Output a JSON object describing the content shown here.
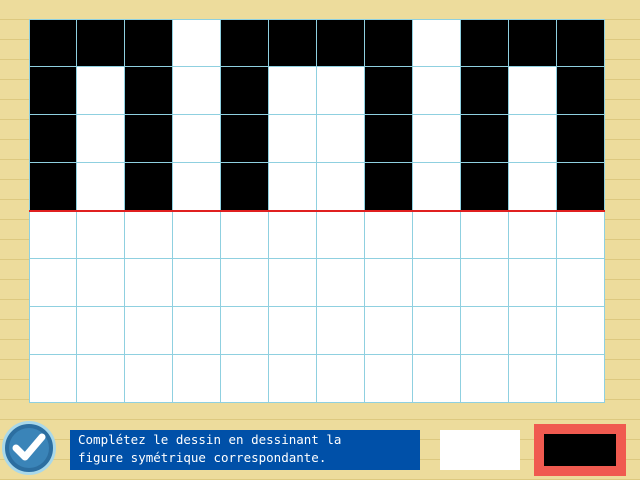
{
  "instruction": "Complétez le dessin en dessinant la\nfigure symétrique correspondante.",
  "palette": {
    "colors": [
      "#ffffff",
      "#000000"
    ],
    "selected": "#000000"
  },
  "grid": {
    "cols": 12,
    "rows": 8,
    "cells": [
      [
        1,
        1,
        1,
        0,
        1,
        1,
        1,
        1,
        0,
        1,
        1,
        1
      ],
      [
        1,
        0,
        1,
        0,
        1,
        0,
        0,
        1,
        0,
        1,
        0,
        1
      ],
      [
        1,
        0,
        1,
        0,
        1,
        0,
        0,
        1,
        0,
        1,
        0,
        1
      ],
      [
        1,
        0,
        1,
        0,
        1,
        0,
        0,
        1,
        0,
        1,
        0,
        1
      ],
      [
        0,
        0,
        0,
        0,
        0,
        0,
        0,
        0,
        0,
        0,
        0,
        0
      ],
      [
        0,
        0,
        0,
        0,
        0,
        0,
        0,
        0,
        0,
        0,
        0,
        0
      ],
      [
        0,
        0,
        0,
        0,
        0,
        0,
        0,
        0,
        0,
        0,
        0,
        0
      ],
      [
        0,
        0,
        0,
        0,
        0,
        0,
        0,
        0,
        0,
        0,
        0,
        0
      ]
    ],
    "axis_color": "#e02020"
  }
}
